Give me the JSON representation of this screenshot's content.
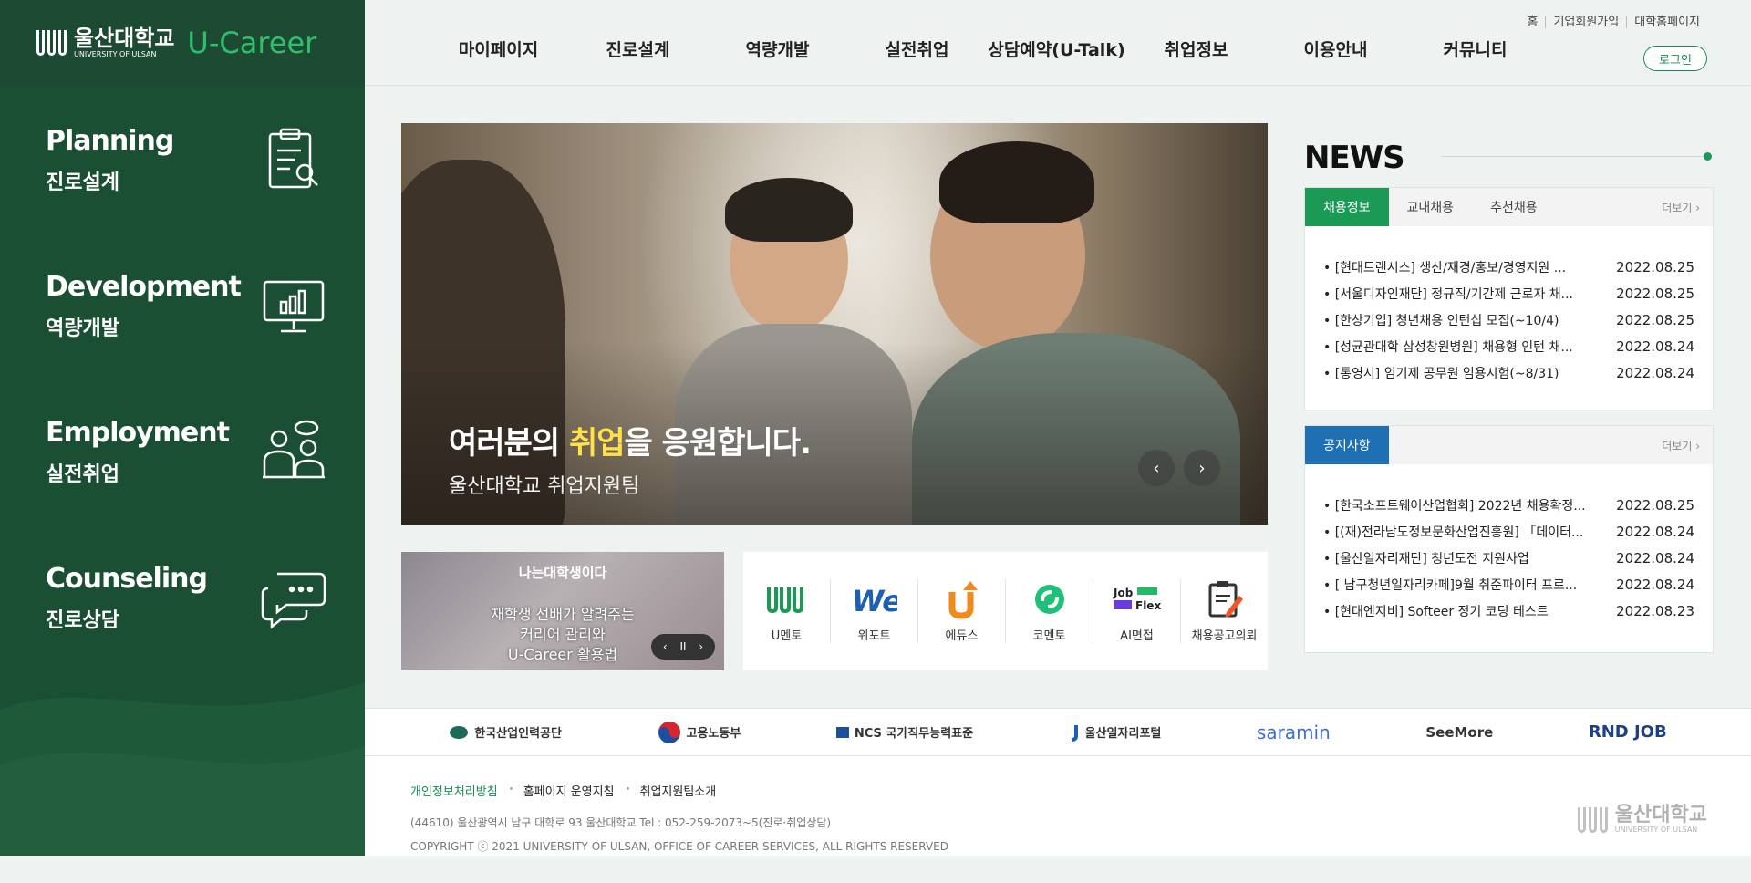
{
  "brand": {
    "logo_kr": "울산대학교",
    "logo_en": "UNIVERSITY OF ULSAN",
    "product": "U-Career"
  },
  "sidebar": {
    "items": [
      {
        "en": "Planning",
        "kr": "진로설계",
        "icon": "clipboard-search-icon"
      },
      {
        "en": "Development",
        "kr": "역량개발",
        "icon": "monitor-chart-icon"
      },
      {
        "en": "Employment",
        "kr": "실전취업",
        "icon": "interview-people-icon"
      },
      {
        "en": "Counseling",
        "kr": "진로상담",
        "icon": "chat-bubbles-icon"
      }
    ]
  },
  "nav": {
    "items": [
      "마이페이지",
      "진로설계",
      "역량개발",
      "실전취업",
      "상담예약(U-Talk)",
      "취업정보",
      "이용안내",
      "커뮤니티"
    ]
  },
  "util": {
    "links": [
      "홈",
      "기업회원가입",
      "대학홈페이지"
    ],
    "login": "로그인"
  },
  "hero": {
    "title_pre": "여러분의 ",
    "title_hl": "취업",
    "title_post": "을 응원합니다.",
    "subtitle": "울산대학교 취업지원팀",
    "prev": "‹",
    "next": "›",
    "highlight_color": "#ffe24a"
  },
  "promo": {
    "top": "나는대학생이다",
    "line1": "재학생 선배가 알려주는",
    "line2": "커리어 관리와",
    "line3": "U-Career 활용법",
    "ctrl_prev": "‹",
    "ctrl_pause": "II",
    "ctrl_next": "›"
  },
  "quick": {
    "items": [
      {
        "label": "U멘토",
        "icon": "umentor-icon"
      },
      {
        "label": "위포트",
        "icon": "weport-icon"
      },
      {
        "label": "에듀스",
        "icon": "educe-icon"
      },
      {
        "label": "코멘토",
        "icon": "comento-icon"
      },
      {
        "label": "AI면접",
        "icon": "jobflex-icon",
        "logo_top": "Job",
        "logo_bottom": "Flex"
      },
      {
        "label": "채용공고의뢰",
        "icon": "clipboard-pen-icon"
      }
    ]
  },
  "news": {
    "title": "NEWS",
    "board1": {
      "tabs": [
        "채용정보",
        "교내채용",
        "추천채용"
      ],
      "active_color": "#1a9a55",
      "more": "더보기",
      "rows": [
        {
          "title": "• [현대트랜시스] 생산/재경/홍보/경영지원 ...",
          "date": "2022.08.25"
        },
        {
          "title": "• [서울디자인재단] 정규직/기간제 근로자 채...",
          "date": "2022.08.25"
        },
        {
          "title": "• [한상기업] 청년채용 인턴십 모집(~10/4)",
          "date": "2022.08.25"
        },
        {
          "title": "• [성균관대학 삼성창원병원] 채용형 인턴 채...",
          "date": "2022.08.24"
        },
        {
          "title": "• [통영시] 임기제 공무원 임용시험(~8/31)",
          "date": "2022.08.24"
        }
      ]
    },
    "board2": {
      "tabs": [
        "공지사항"
      ],
      "active_color": "#1f6fb5",
      "more": "더보기",
      "rows": [
        {
          "title": "• [한국소프트웨어산업협회] 2022년 채용확정...",
          "date": "2022.08.25"
        },
        {
          "title": "• [(재)전라남도정보문화산업진흥원] 「데이터...",
          "date": "2022.08.24"
        },
        {
          "title": "• [울산일자리재단] 청년도전 지원사업",
          "date": "2022.08.24"
        },
        {
          "title": "• [ 남구청년일자리카페]9월 취준파이터 프로...",
          "date": "2022.08.24"
        },
        {
          "title": "• [현대엔지비] Softeer 정기 코딩 테스트",
          "date": "2022.08.23"
        }
      ]
    }
  },
  "partners": [
    {
      "name": "한국산업인력공단",
      "icon": "hrdkorea-icon"
    },
    {
      "name": "고용노동부",
      "icon": "taegeuk-icon"
    },
    {
      "name": "NCS 국가직무능력표준",
      "icon": "ncs-icon"
    },
    {
      "name": "울산일자리포털",
      "icon": "ulsan-job-icon"
    },
    {
      "name": "saramin",
      "icon": "saramin-icon"
    },
    {
      "name": "SeeMore",
      "icon": "seemore-icon"
    },
    {
      "name": "RND JOB",
      "icon": "rndjob-icon"
    }
  ],
  "footer": {
    "links": [
      "개인정보처리방침",
      "홈페이지 운영지침",
      "취업지원팀소개"
    ],
    "address": "(44610) 울산광역시 남구 대학로 93 울산대학교 Tel : 052-259-2073~5(진로·취업상담)",
    "copyright": "COPYRIGHT ⓒ 2021 UNIVERSITY OF ULSAN, OFFICE OF CAREER SERVICES, ALL RIGHTS RESERVED",
    "logo_kr": "울산대학교",
    "logo_en": "UNIVERSITY OF ULSAN"
  }
}
